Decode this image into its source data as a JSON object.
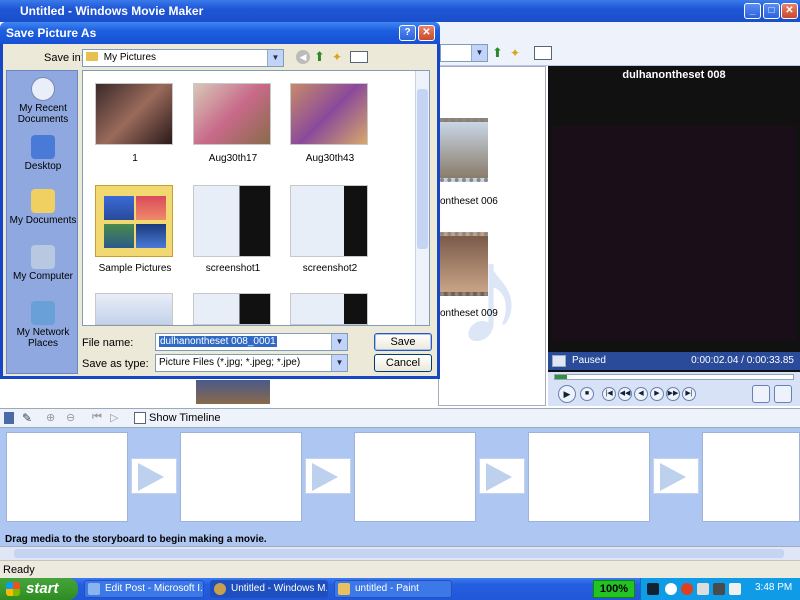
{
  "main_window": {
    "title": "Untitled - Windows Movie Maker",
    "minimize": "_",
    "maximize": "□",
    "close": "✕"
  },
  "monitor": {
    "title": "dulhanontheset 008",
    "status": "Paused",
    "time": "0:00:02.04 / 0:00:33.85"
  },
  "collection_labels": [
    "ontheset 006",
    "ontheset 009"
  ],
  "storyboard": {
    "show_timeline_label": "Show Timeline",
    "hint": "Drag media to the storyboard to begin making a movie."
  },
  "status_bar": {
    "text": "Ready"
  },
  "taskbar": {
    "start_label": "start",
    "tasks": [
      "Edit Post - Microsoft I...",
      "Untitled - Windows M...",
      "untitled - Paint"
    ],
    "zoom": "100%",
    "clock": "3:48 PM"
  },
  "dialog": {
    "title": "Save Picture As",
    "help": "?",
    "close": "✕",
    "save_in_label": "Save in:",
    "save_in_value": "My Pictures",
    "places": [
      "My Recent Documents",
      "Desktop",
      "My Documents",
      "My Computer",
      "My Network Places"
    ],
    "files": [
      "1",
      "Aug30th17",
      "Aug30th43",
      "Sample Pictures",
      "screenshot1",
      "screenshot2"
    ],
    "file_name_label": "File name:",
    "file_name_value": "dulhanontheset 008_0001",
    "save_as_type_label": "Save as type:",
    "save_as_type_value": "Picture Files (*.jpg; *.jpeg; *.jpe)",
    "save_button": "Save",
    "cancel_button": "Cancel"
  }
}
